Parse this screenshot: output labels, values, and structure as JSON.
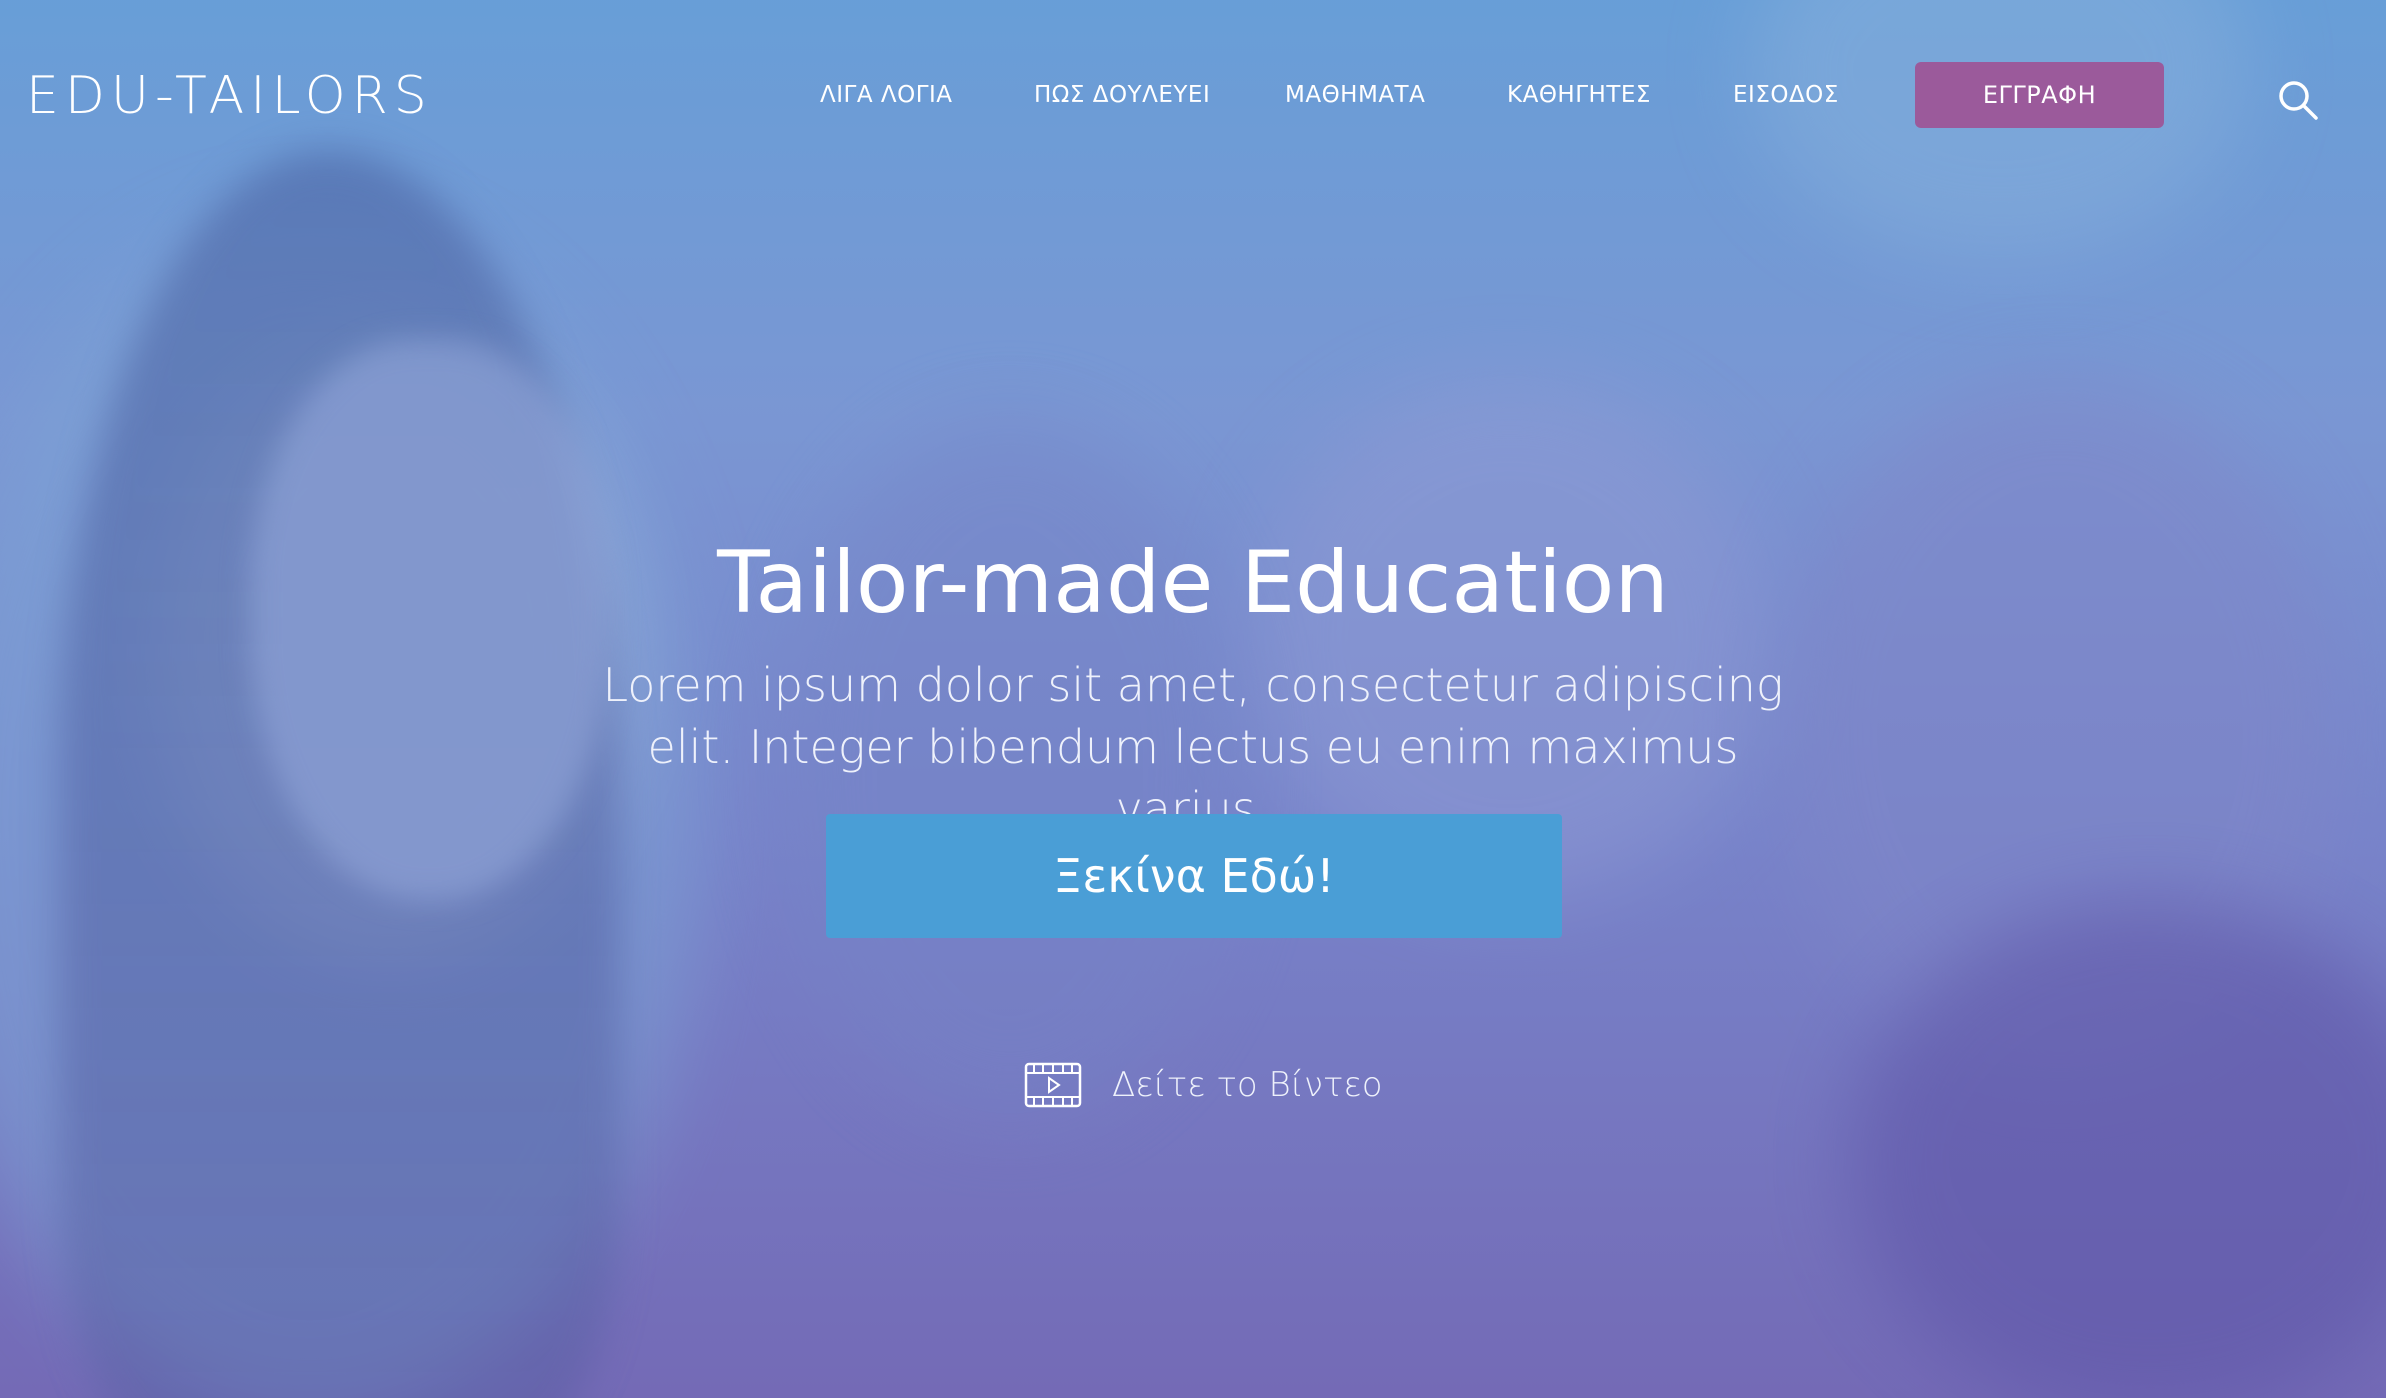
{
  "brand": {
    "logo_text": "EDU-TAILORS"
  },
  "nav": {
    "links": [
      {
        "label": "ΛΙΓΑ ΛΟΓΙΑ"
      },
      {
        "label": "ΠΩΣ ΔΟΥΛΕΥΕΙ"
      },
      {
        "label": "ΜΑΘΗΜΑΤΑ"
      },
      {
        "label": "ΚΑΘΗΓΗΤΕΣ"
      },
      {
        "label": "ΕΙΣΟΔΟΣ"
      }
    ],
    "register_label": "ΕΓΓΡΑΦΗ",
    "search_icon": "search-icon"
  },
  "hero": {
    "title": "Tailor-made Education",
    "subtitle": "Lorem ipsum dolor sit amet, consectetur adipiscing elit. Integer bibendum lectus eu enim maximus varius.",
    "cta_label": "Ξεκίνα Εδώ!",
    "video_label": "Δείτε το Βίντεο",
    "video_icon": "film-play-icon"
  },
  "colors": {
    "register_button": "#9b5a9b",
    "cta_button": "#4a9ed6",
    "overlay_top": "#5b96d4",
    "overlay_bottom": "#6c62b2"
  }
}
